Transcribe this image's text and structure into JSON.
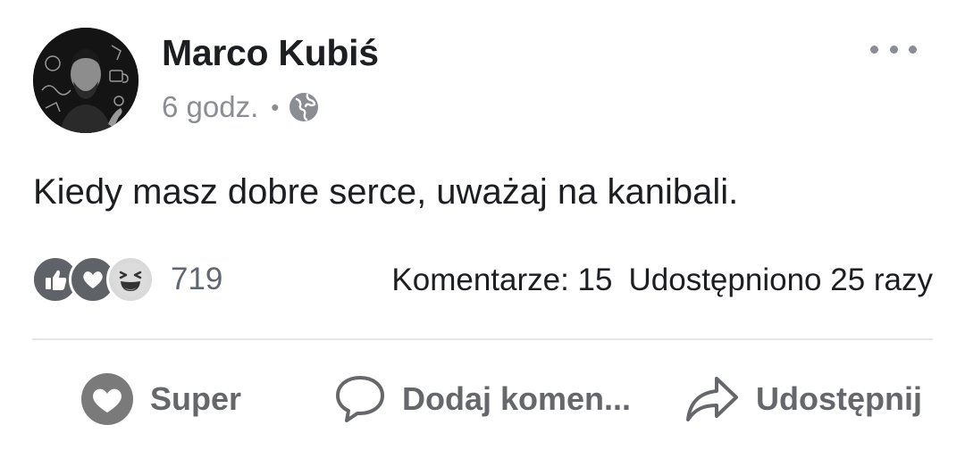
{
  "post": {
    "author": "Marco Kubiś",
    "time": "6 godz.",
    "separator": "•",
    "audience_icon": "globe-icon",
    "text": "Kiedy masz dobre serce, uważaj na kanibali."
  },
  "reactions": {
    "icons": [
      "like-icon",
      "love-icon",
      "haha-icon"
    ],
    "count": "719"
  },
  "stats": {
    "comments": "Komentarze: 15",
    "shares": "Udostępniono 25 razy"
  },
  "actions": {
    "react_label": "Super",
    "comment_label": "Dodaj komen...",
    "share_label": "Udostępnij"
  },
  "colors": {
    "text": "#1c1e21",
    "secondary": "#8a8d91",
    "action": "#65676b",
    "divider": "#e4e6eb"
  }
}
